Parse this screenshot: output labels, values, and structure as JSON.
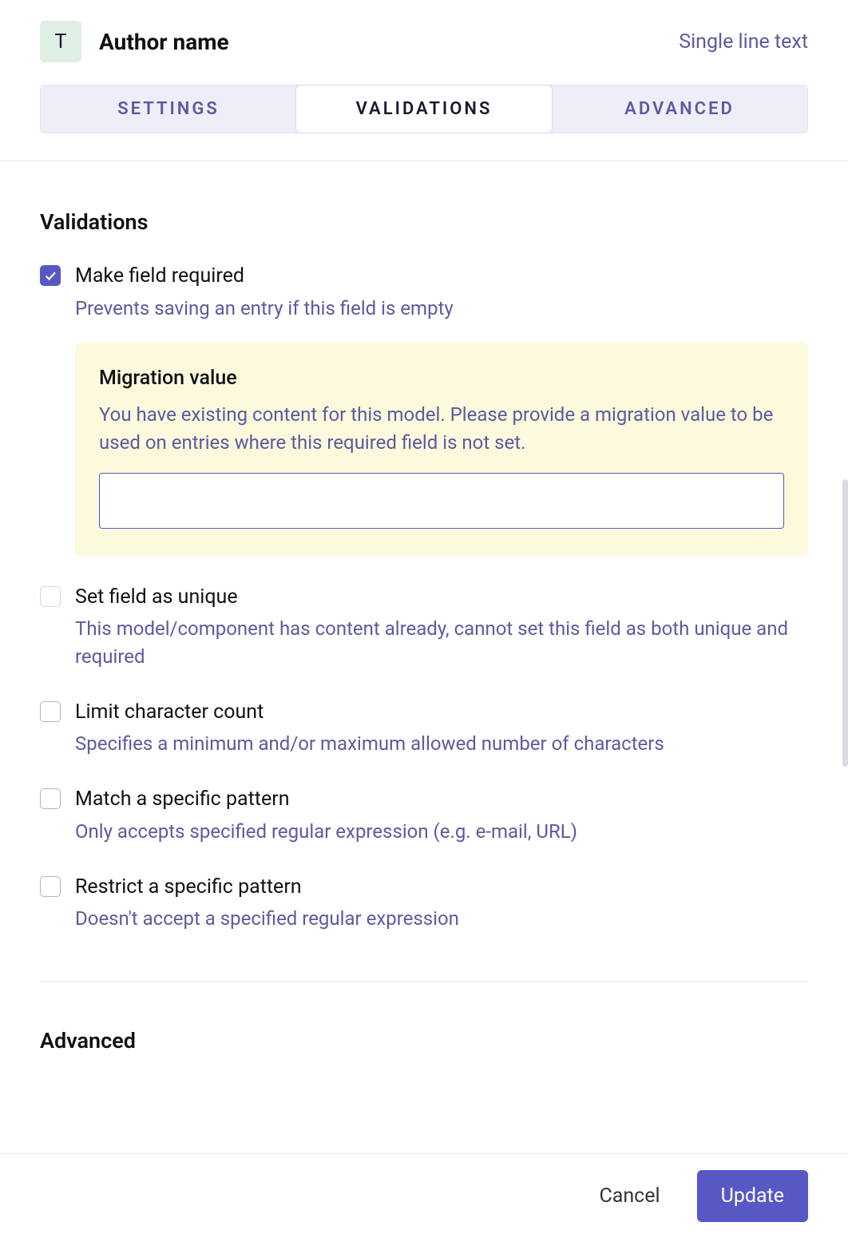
{
  "header": {
    "icon_letter": "T",
    "field_name": "Author name",
    "field_type": "Single line text"
  },
  "tabs": {
    "settings": "Settings",
    "validations": "Validations",
    "advanced": "Advanced",
    "active": "validations"
  },
  "sections": {
    "validations_title": "Validations",
    "advanced_title": "Advanced"
  },
  "validations": {
    "required": {
      "label": "Make field required",
      "description": "Prevents saving an entry if this field is empty",
      "checked": true
    },
    "migration": {
      "title": "Migration value",
      "description": "You have existing content for this model. Please provide a migration value to be used on entries where this required field is not set.",
      "value": ""
    },
    "unique": {
      "label": "Set field as unique",
      "description": "This model/component has content already, cannot set this field as both unique and required",
      "checked": false,
      "disabled": true
    },
    "limit": {
      "label": "Limit character count",
      "description": "Specifies a minimum and/or maximum allowed number of characters",
      "checked": false
    },
    "match": {
      "label": "Match a specific pattern",
      "description": "Only accepts specified regular expression (e.g. e-mail, URL)",
      "checked": false
    },
    "restrict": {
      "label": "Restrict a specific pattern",
      "description": "Doesn't accept a specified regular expression",
      "checked": false
    }
  },
  "footer": {
    "cancel": "Cancel",
    "update": "Update"
  }
}
